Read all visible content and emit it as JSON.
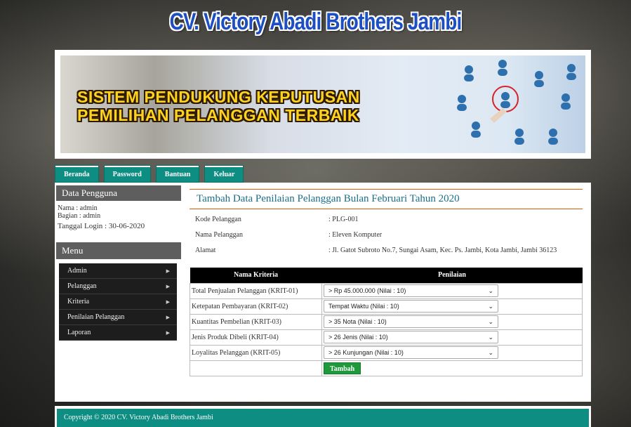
{
  "site_title": "CV. Victory Abadi Brothers Jambi",
  "banner": {
    "line1": "SISTEM PENDUKUNG KEPUTUSAN",
    "line2": "PEMILIHAN PELANGGAN TERBAIK"
  },
  "nav": {
    "items": [
      "Beranda",
      "Password",
      "Bantuan",
      "Keluar"
    ]
  },
  "sidebar": {
    "user_heading": "Data Pengguna",
    "nama": "Nama : admin",
    "bagian": "Bagian : admin",
    "login": "Tanggal Login : 30-06-2020",
    "menu_heading": "Menu",
    "menu_items": [
      "Admin",
      "Pelanggan",
      "Kriteria",
      "Penilaian Pelanggan",
      "Laporan"
    ]
  },
  "main": {
    "title": "Tambah Data Penilaian Pelanggan Bulan Februari Tahun 2020",
    "info": [
      {
        "label": "Kode Pelanggan",
        "value": ": PLG-001"
      },
      {
        "label": "Nama Pelanggan",
        "value": ": Eleven Komputer"
      },
      {
        "label": "Alamat",
        "value": ": Jl. Gatot Subroto No.7, Sungai Asam, Kec. Ps. Jambi, Kota Jambi, Jambi 36123"
      }
    ],
    "table_headers": {
      "kriteria": "Nama Kriteria",
      "penilaian": "Penilaian"
    },
    "rows": [
      {
        "kriteria": "Total Penjualan Pelanggan (KRIT-01)",
        "selected": "> Rp 45.000.000 (Nilai : 10)"
      },
      {
        "kriteria": "Ketepatan Pembayaran (KRIT-02)",
        "selected": "Tempat Waktu (Nilai : 10)"
      },
      {
        "kriteria": "Kuantitas Pembelian (KRIT-03)",
        "selected": "> 35 Nota (Nilai : 10)"
      },
      {
        "kriteria": "Jenis Produk Dibeli (KRIT-04)",
        "selected": "> 26 Jenis (Nilai : 10)"
      },
      {
        "kriteria": "Loyalitas Pelanggan (KRIT-05)",
        "selected": "> 26 Kunjungan (Nilai : 10)"
      }
    ],
    "submit_label": "Tambah"
  },
  "footer": {
    "text": "Copyright © 2020 CV. Victory Abadi Brothers Jambi"
  },
  "colors": {
    "accent_teal": "#0e8e82",
    "title_blue": "#1e4fc2",
    "heading_teal": "#1a6e88",
    "rule_orange": "#e05a00",
    "button_green": "#1e9a3a"
  },
  "icons": {
    "menu_arrow": "caret-right-icon",
    "select_chevron": "chevron-down-icon"
  }
}
